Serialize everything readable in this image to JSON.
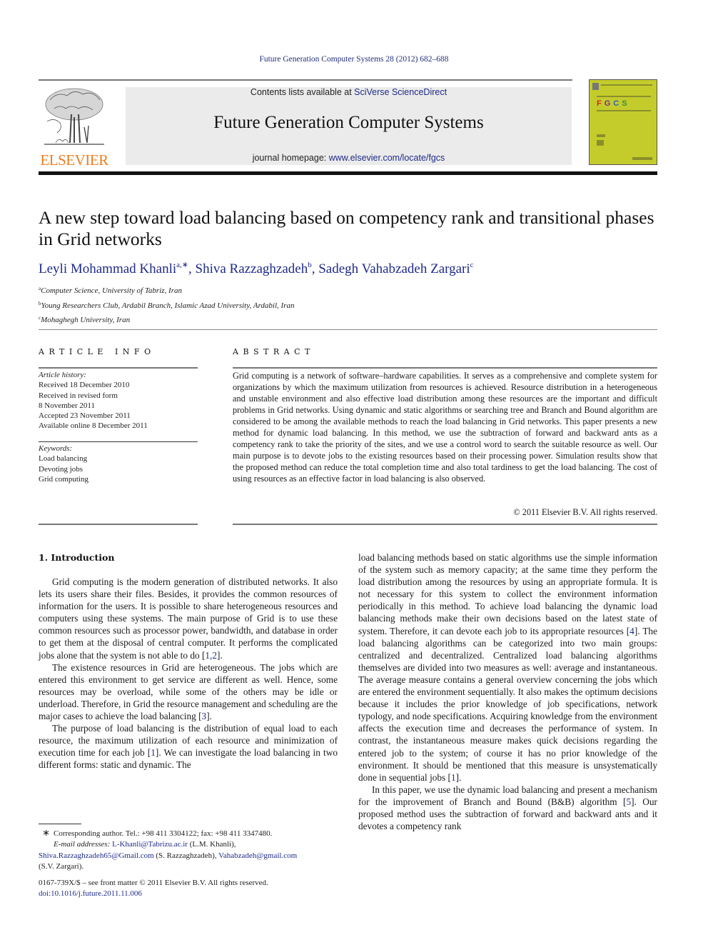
{
  "header": {
    "citation": "Future Generation Computer Systems 28 (2012) 682–688",
    "contents_prefix": "Contents lists available at ",
    "contents_link": "SciVerse ScienceDirect",
    "journal_title": "Future Generation Computer Systems",
    "homepage_prefix": "journal homepage: ",
    "homepage_link": "www.elsevier.com/locate/fgcs",
    "publisher_logo_text": "ELSEVIER",
    "cover_letters": [
      "F",
      "G",
      "C",
      "S"
    ],
    "cover_letter_colors": [
      "#d8251b",
      "#7b2d8e",
      "#2a62b8",
      "#3b8f3a"
    ]
  },
  "article": {
    "title": "A new step toward load balancing based on competency rank and transitional phases in Grid networks",
    "authors": [
      {
        "name": "Leyli Mohammad Khanli",
        "sup": "a,∗",
        "sep": ", "
      },
      {
        "name": "Shiva Razzaghzadeh",
        "sup": "b",
        "sep": ", "
      },
      {
        "name": "Sadegh Vahabzadeh Zargari",
        "sup": "c",
        "sep": ""
      }
    ],
    "affiliations": [
      {
        "sup": "a",
        "text": "Computer Science, University of Tabriz, Iran"
      },
      {
        "sup": "b",
        "text": "Young Researchers Club, Ardabil Branch, Islamic Azad University, Ardabil, Iran"
      },
      {
        "sup": "c",
        "text": "Mohaghegh University, Iran"
      }
    ]
  },
  "article_info": {
    "label": "ARTICLE INFO",
    "history_heading": "Article history:",
    "history": [
      "Received 18 December 2010",
      "Received in revised form",
      "8 November 2011",
      "Accepted 23 November 2011",
      "Available online 8 December 2011"
    ],
    "keywords_heading": "Keywords:",
    "keywords": [
      "Load balancing",
      "Devoting jobs",
      "Grid computing"
    ]
  },
  "abstract": {
    "label": "ABSTRACT",
    "text": "Grid computing is a network of software–hardware capabilities. It serves as a comprehensive and complete system for organizations by which the maximum utilization from resources is achieved. Resource distribution in a heterogeneous and unstable environment and also effective load distribution among these resources are the important and difficult problems in Grid networks. Using dynamic and static algorithms or searching tree and Branch and Bound algorithm are considered to be among the available methods to reach the load balancing in Grid networks. This paper presents a new method for dynamic load balancing. In this method, we use the subtraction of forward and backward ants as a competency rank to take the priority of the sites, and we use a control word to search the suitable resource as well. Our main purpose is to devote jobs to the existing resources based on their processing power. Simulation results show that the proposed method can reduce the total completion time and also total tardiness to get the load balancing. The cost of using resources as an effective factor in load balancing is also observed.",
    "copyright": "© 2011 Elsevier B.V. All rights reserved."
  },
  "body": {
    "section_heading": "1.  Introduction",
    "left_paragraphs": [
      {
        "parts": [
          {
            "t": "Grid computing is the modern generation of distributed networks. It also lets its users share their files. Besides, it provides the common resources of information for the users. It is possible to share heterogeneous resources and computers using these systems. The main purpose of Grid is to use these common resources such as processor power, bandwidth, and database in order to get them at the disposal of central computer. It performs the complicated jobs alone that the system is not able to do ["
          },
          {
            "t": "1,2",
            "ref": true
          },
          {
            "t": "]."
          }
        ]
      },
      {
        "parts": [
          {
            "t": "The existence resources in Grid are heterogeneous. The jobs which are entered this environment to get service are different as well. Hence, some resources may be overload, while some of the others may be idle or underload. Therefore, in Grid the resource management and scheduling are the major cases to achieve the load balancing ["
          },
          {
            "t": "3",
            "ref": true
          },
          {
            "t": "]."
          }
        ]
      },
      {
        "parts": [
          {
            "t": "The purpose of load balancing is the distribution of equal load to each resource, the maximum utilization of each resource and minimization of execution time for each job ["
          },
          {
            "t": "1",
            "ref": true
          },
          {
            "t": "]. We can investigate the load balancing in two different forms: static and dynamic. The"
          }
        ]
      }
    ],
    "right_paragraphs": [
      {
        "noindent": true,
        "parts": [
          {
            "t": "load balancing methods based on static algorithms use the simple information of the system such as memory capacity; at the same time they perform the load distribution among the resources by using an appropriate formula. It is not necessary for this system to collect the environment information periodically in this method. To achieve load balancing the dynamic load balancing methods make their own decisions based on the latest state of system. Therefore, it can devote each job to its appropriate resources ["
          },
          {
            "t": "4",
            "ref": true
          },
          {
            "t": "]. The load balancing algorithms can be categorized into two main groups: centralized and decentralized. Centralized load balancing algorithms themselves are divided into two measures as well: average and instantaneous. The average measure contains a general overview concerning the jobs which are entered the environment sequentially. It also makes the optimum decisions because it includes the prior knowledge of job specifications, network typology, and node specifications. Acquiring knowledge from the environment affects the execution time and decreases the performance of system. In contrast, the instantaneous measure makes quick decisions regarding the entered job to the system; of course it has no prior knowledge of the environment. It should be mentioned that this measure is unsystematically done in sequential jobs ["
          },
          {
            "t": "1",
            "ref": true
          },
          {
            "t": "]."
          }
        ]
      },
      {
        "parts": [
          {
            "t": "In this paper, we use the dynamic load balancing and present a mechanism for the improvement of Branch and Bound (B&B) algorithm ["
          },
          {
            "t": "5",
            "ref": true
          },
          {
            "t": "]. Our proposed method uses the subtraction of forward and backward ants and it devotes a competency rank"
          }
        ]
      }
    ]
  },
  "footnote": {
    "star": "∗",
    "corresponding": "Corresponding author. Tel.: +98 411 3304122; fax: +98 411 3347480.",
    "email_label": "E-mail addresses: ",
    "emails": [
      {
        "addr": "L-Khanli@Tabrizu.ac.ir",
        "who": " (L.M. Khanli),"
      },
      {
        "addr": "Shiva.Razzaghzadeh65@Gmail.com",
        "who": " (S. Razzaghzadeh), "
      },
      {
        "addr": "Vahabzadeh@gmail.com",
        "who": ""
      }
    ],
    "last_who": "(S.V. Zargari).",
    "frontmatter": "0167-739X/$ – see front matter © 2011 Elsevier B.V. All rights reserved.",
    "doi": "doi:10.1016/j.future.2011.11.006"
  }
}
